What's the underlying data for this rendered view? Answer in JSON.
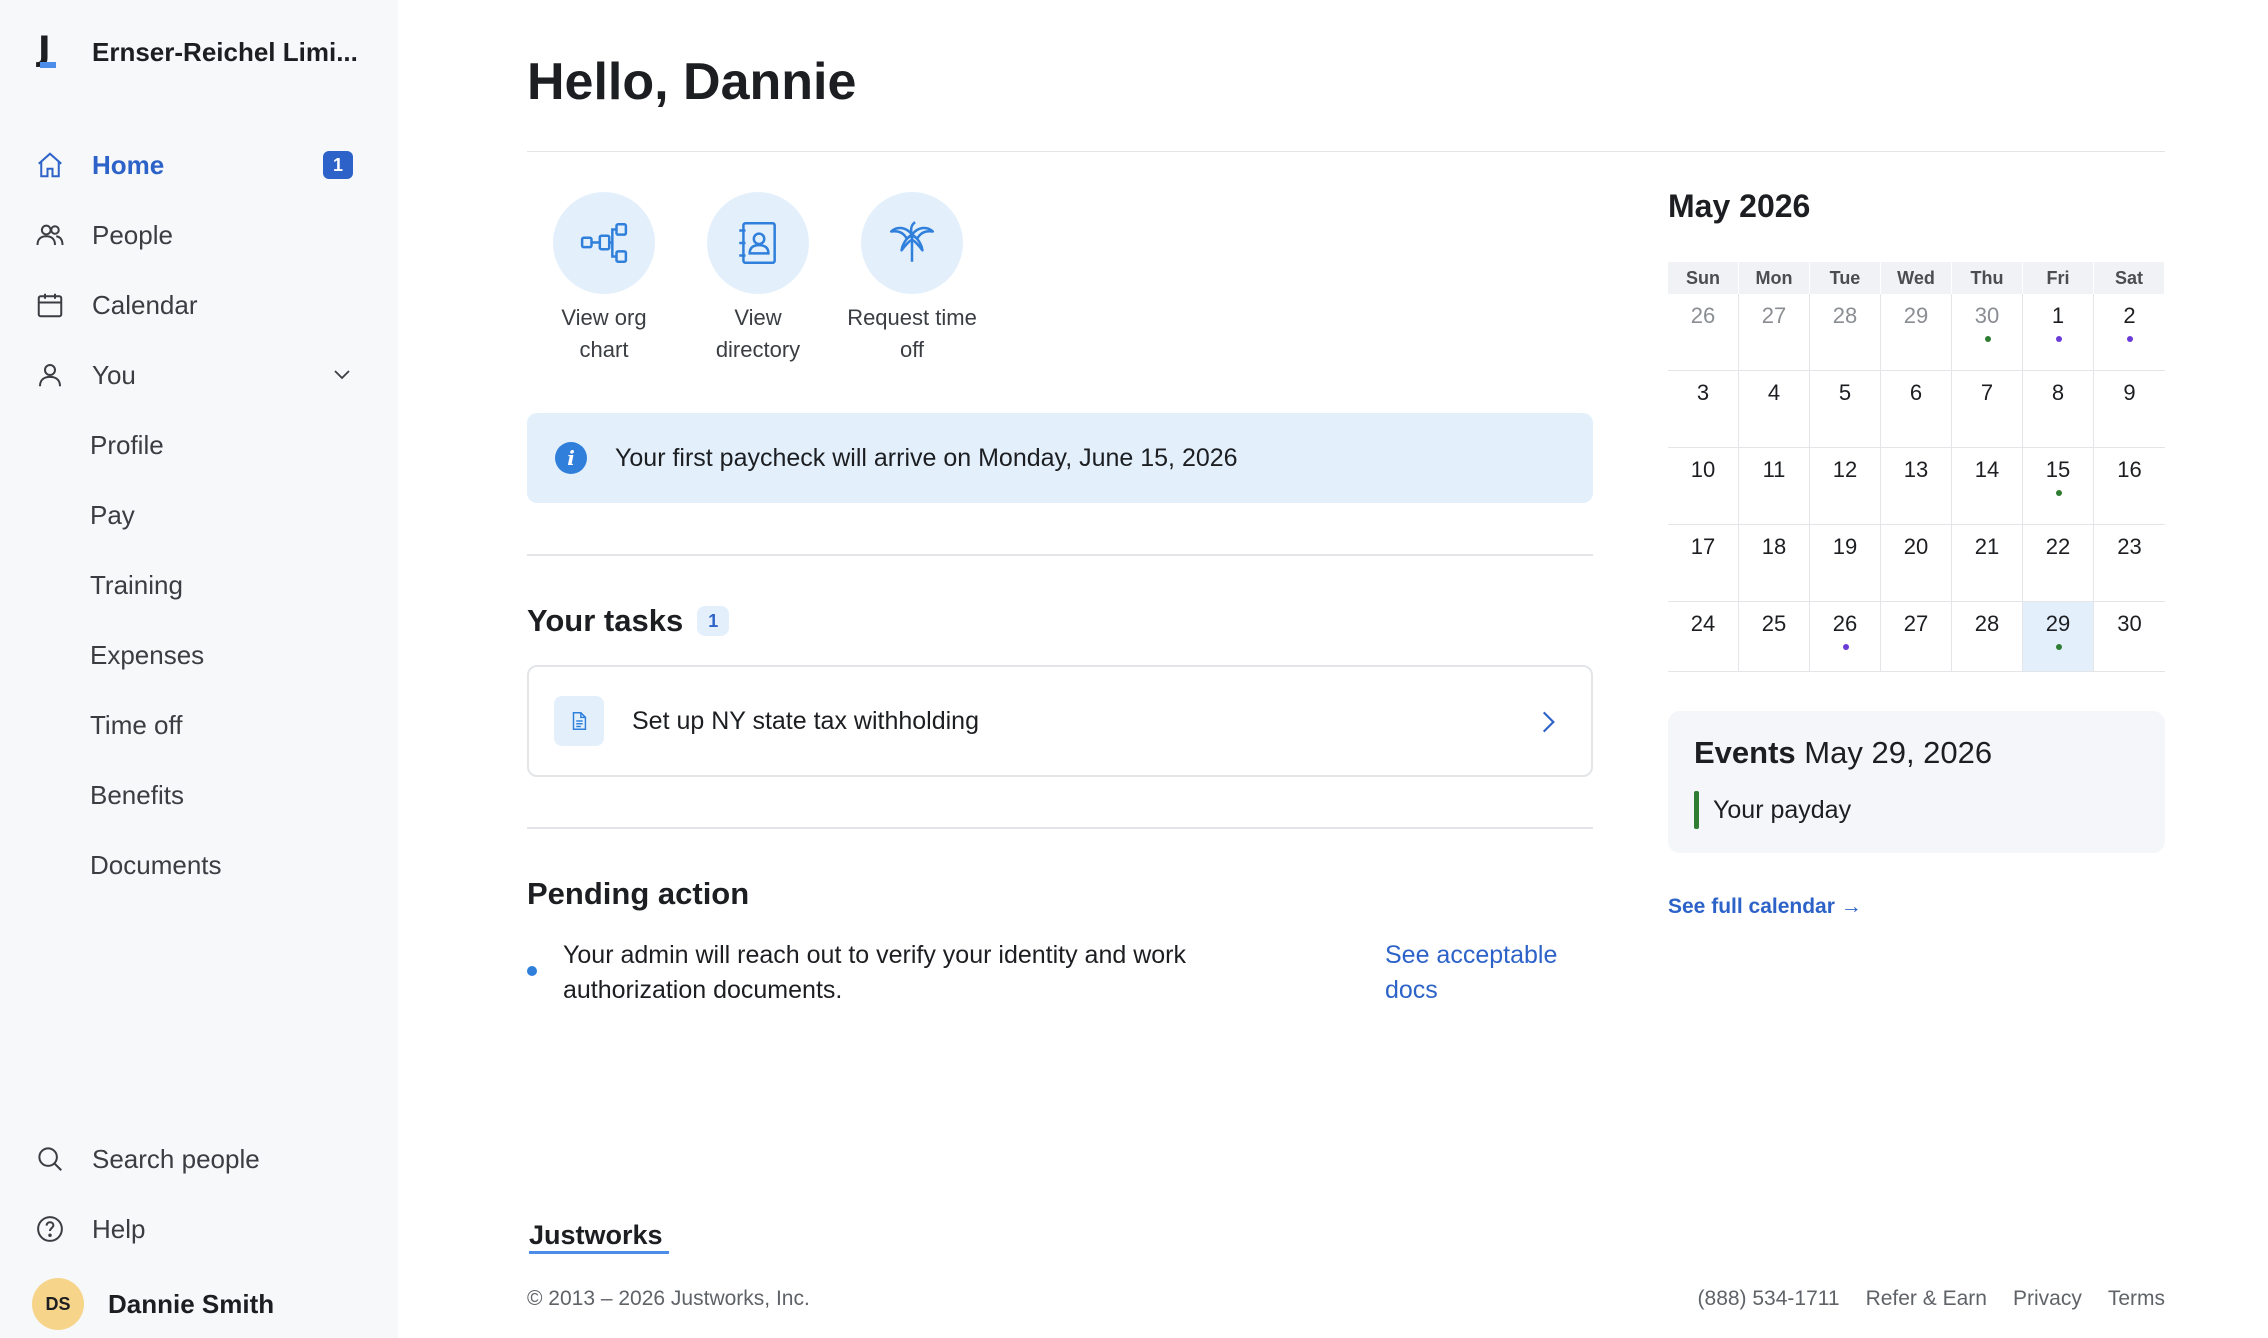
{
  "sidebar": {
    "company": "Ernser-Reichel Limi...",
    "nav": [
      {
        "label": "Home",
        "badge": "1"
      },
      {
        "label": "People"
      },
      {
        "label": "Calendar"
      },
      {
        "label": "You"
      }
    ],
    "sub_nav": [
      "Profile",
      "Pay",
      "Training",
      "Expenses",
      "Time off",
      "Benefits",
      "Documents"
    ],
    "bottom": [
      "Search people",
      "Help"
    ],
    "user": {
      "initials": "DS",
      "name": "Dannie Smith"
    }
  },
  "main": {
    "greeting": "Hello, Dannie",
    "quick_actions": [
      {
        "label": "View org chart",
        "icon": "org-chart-icon"
      },
      {
        "label": "View directory",
        "icon": "directory-icon"
      },
      {
        "label": "Request time off",
        "icon": "palm-tree-icon"
      }
    ],
    "banner": "Your first paycheck will arrive on Monday, June 15, 2026",
    "tasks": {
      "title": "Your tasks",
      "count": "1",
      "items": [
        {
          "label": "Set up NY state tax withholding"
        }
      ]
    },
    "pending": {
      "title": "Pending action",
      "text": "Your admin will reach out to verify your identity and work authorization documents.",
      "link": "See acceptable docs"
    }
  },
  "calendar": {
    "title": "May 2026",
    "weekdays": [
      "Sun",
      "Mon",
      "Tue",
      "Wed",
      "Thu",
      "Fri",
      "Sat"
    ],
    "weeks": [
      [
        "26",
        "27",
        "28",
        "29",
        "30",
        "1",
        "2"
      ],
      [
        "3",
        "4",
        "5",
        "6",
        "7",
        "8",
        "9"
      ],
      [
        "10",
        "11",
        "12",
        "13",
        "14",
        "15",
        "16"
      ],
      [
        "17",
        "18",
        "19",
        "20",
        "21",
        "22",
        "23"
      ],
      [
        "24",
        "25",
        "26",
        "27",
        "28",
        "29",
        "30"
      ]
    ],
    "events": {
      "heading_bold": "Events",
      "heading_date": "May 29, 2026",
      "items": [
        "Your payday"
      ]
    },
    "full_calendar_link": "See full calendar →"
  },
  "footer": {
    "logo": "Justworks",
    "copyright": "© 2013 – 2026 Justworks, Inc.",
    "links": [
      "(888) 534-1711",
      "Refer & Earn",
      "Privacy",
      "Terms"
    ]
  },
  "colors": {
    "accent": "#2d63c8",
    "light_blue": "#e3f0fc",
    "green_dot": "#2e7d32",
    "purple_dot": "#6a3bd8"
  }
}
